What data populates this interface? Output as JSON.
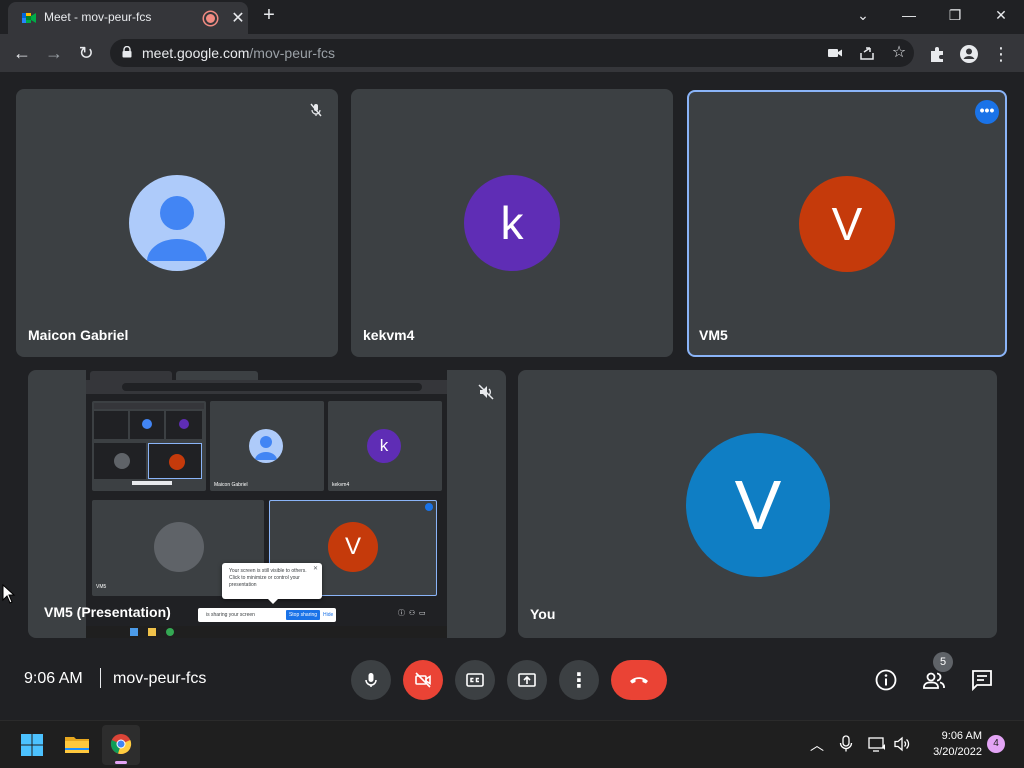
{
  "browser": {
    "tab_title": "Meet - mov-peur-fcs",
    "url_host": "meet.google.com",
    "url_path": "/mov-peur-fcs"
  },
  "meet": {
    "tiles": [
      {
        "name": "Maicon Gabriel",
        "avatar_type": "default-person",
        "muted": true
      },
      {
        "name": "kekvm4",
        "avatar_letter": "k",
        "avatar_color": "#5f2db5"
      },
      {
        "name": "VM5",
        "avatar_letter": "V",
        "avatar_color": "#c53a0b",
        "highlighted": true
      },
      {
        "name": "VM5 (Presentation)",
        "muted": true
      },
      {
        "name": "You",
        "avatar_letter": "V",
        "avatar_color": "#0f7ec4"
      }
    ],
    "presentation": {
      "mini_tiles": [
        {
          "name": "Maicon Gabriel"
        },
        {
          "name": "kekvm4",
          "letter": "k"
        },
        {
          "name": "VM5"
        },
        {
          "name": "VM5",
          "letter": "V"
        }
      ],
      "popup_text": "Your screen is still visible to others. Click to minimize or control your presentation",
      "stop_label": "Stop sharing",
      "hide_label": "Hide",
      "sharing_text": "is sharing your screen"
    },
    "footer": {
      "time": "9:06 AM",
      "meeting_code": "mov-peur-fcs",
      "people_count": "5"
    },
    "colors": {
      "accent": "#8ab4f8",
      "end_call": "#ea4335",
      "blue_badge": "#1a73e8"
    }
  },
  "taskbar": {
    "time": "9:06 AM",
    "date": "3/20/2022",
    "notification_count": "4"
  }
}
